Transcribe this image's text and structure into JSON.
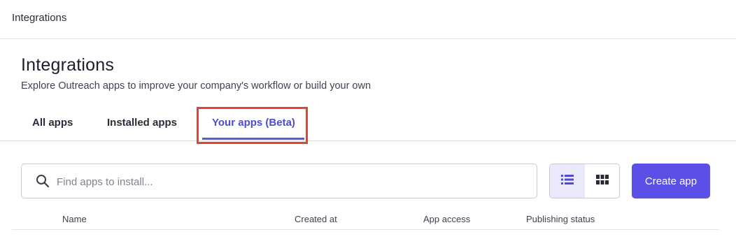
{
  "topbar": {
    "title": "Integrations"
  },
  "header": {
    "title": "Integrations",
    "subtitle": "Explore Outreach apps to improve your company's workflow or build your own"
  },
  "tabs": [
    {
      "label": "All apps"
    },
    {
      "label": "Installed apps"
    },
    {
      "label": "Your apps (Beta)",
      "active": true
    }
  ],
  "toolbar": {
    "search_placeholder": "Find apps to install...",
    "search_value": "",
    "view_modes": [
      {
        "icon": "list-view-icon",
        "active": true
      },
      {
        "icon": "grid-view-icon",
        "active": false
      }
    ],
    "create_label": "Create app"
  },
  "table": {
    "columns": [
      "Name",
      "Created at",
      "App access",
      "Publishing status"
    ]
  },
  "colors": {
    "accent": "#5a4fe6",
    "active_tab_text": "#4f4bd8",
    "highlight_box": "#e5432b",
    "view_active_bg": "#e9e9fb"
  }
}
